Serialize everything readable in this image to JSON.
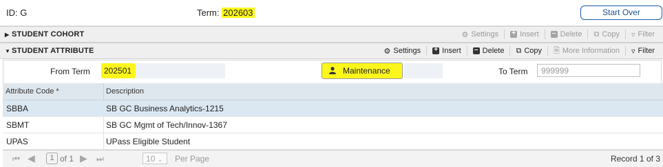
{
  "header": {
    "id_label": "ID: G",
    "term_label": "Term: ",
    "term_value": "202603",
    "start_over": "Start Over"
  },
  "cohort": {
    "title": "STUDENT COHORT",
    "tools": {
      "settings": "Settings",
      "insert": "Insert",
      "delete": "Delete",
      "copy": "Copy",
      "filter": "Filter"
    }
  },
  "attribute": {
    "title": "STUDENT ATTRIBUTE",
    "tools": {
      "settings": "Settings",
      "insert": "Insert",
      "delete": "Delete",
      "copy": "Copy",
      "more": "More Information",
      "filter": "Filter"
    }
  },
  "keyblock": {
    "from_term_label": "From Term",
    "from_term_value": "202501",
    "maintenance": "Maintenance",
    "to_term_label": "To Term",
    "to_term_placeholder": "999999"
  },
  "table": {
    "columns": [
      "Attribute Code *",
      "Description"
    ],
    "rows": [
      {
        "code": "SBBA",
        "description": "SB GC Business Analytics-1215"
      },
      {
        "code": "SBMT",
        "description": "SB GC Mgmt of Tech/Innov-1367"
      },
      {
        "code": "UPAS",
        "description": "UPass Eligible Student"
      }
    ]
  },
  "pager": {
    "page": "1",
    "of": "of 1",
    "per_page_value": "10",
    "per_page_label": "Per Page",
    "record": "Record 1 of 3"
  },
  "colors": {
    "highlight": "#fdf61c",
    "accent": "#1a5aa6",
    "selected_row": "#dbe8f2"
  }
}
